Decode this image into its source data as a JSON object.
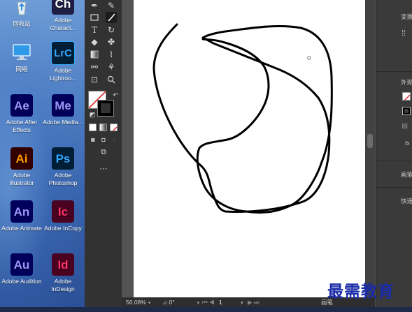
{
  "desktop": {
    "icons": [
      {
        "label": "回收站",
        "tile_text": "",
        "bg": "",
        "fg": ""
      },
      {
        "label": "Adobe Charact...",
        "tile_text": "Ch",
        "bg": "#1f1f45",
        "fg": "#ffffff"
      },
      {
        "label": "网络",
        "tile_text": "",
        "bg": "",
        "fg": ""
      },
      {
        "label": "Adobe Lightroo...",
        "tile_text": "LrC",
        "bg": "#001e36",
        "fg": "#31a8ff"
      },
      {
        "label": "Adobe After Effects",
        "tile_text": "Ae",
        "bg": "#00005b",
        "fg": "#9999ff"
      },
      {
        "label": "Adobe Media...",
        "tile_text": "Me",
        "bg": "#00005b",
        "fg": "#9999ff"
      },
      {
        "label": "Adobe Illustrator",
        "tile_text": "Ai",
        "bg": "#330000",
        "fg": "#ff9a00"
      },
      {
        "label": "Adobe Photoshop",
        "tile_text": "Ps",
        "bg": "#001e36",
        "fg": "#31a8ff"
      },
      {
        "label": "Adobe Animate",
        "tile_text": "An",
        "bg": "#00005b",
        "fg": "#9999ff"
      },
      {
        "label": "Adobe InCopy",
        "tile_text": "Ic",
        "bg": "#49021f",
        "fg": "#ff3366"
      },
      {
        "label": "Adobe Audition",
        "tile_text": "Au",
        "bg": "#00005b",
        "fg": "#9999ff"
      },
      {
        "label": "Adobe InDesign",
        "tile_text": "Id",
        "bg": "#49021f",
        "fg": "#ff3366"
      }
    ]
  },
  "illustrator": {
    "accent": "#535353",
    "status": {
      "zoom": "56.08%",
      "rotation": "0°",
      "artboard_number": "1",
      "tool_name": "画笔"
    },
    "right_panel": {
      "top_label": "变换",
      "appearance_label": "外观",
      "fx_label": "fx",
      "brush_label": "画笔",
      "quick_label": "快速"
    }
  },
  "watermark": "最需教育"
}
